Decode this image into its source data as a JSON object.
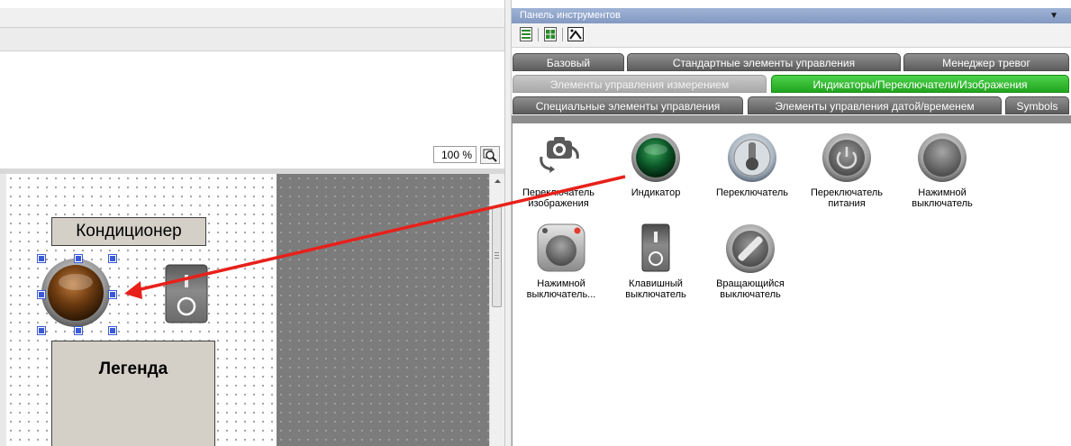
{
  "designer": {
    "zoom": "100 %",
    "label_top": "Кондиционер",
    "label_legend": "Легенда"
  },
  "toolbox": {
    "title": "Панель инструментов",
    "tabs_row1": [
      "Базовый",
      "Стандартные элементы управления",
      "Менеджер тревог"
    ],
    "tabs_row2": [
      "Элементы управления измерением",
      "Индикаторы/Переключатели/Изображения"
    ],
    "tabs_row3": [
      "Специальные элементы управления",
      "Элементы управления датой/временем",
      "Symbols"
    ],
    "active_tab": "Индикаторы/Переключатели/Изображения",
    "items_row1": [
      {
        "label": "Переключатель изображения",
        "icon": "image-switch-icon"
      },
      {
        "label": "Индикатор",
        "icon": "indicator-lamp-icon"
      },
      {
        "label": "Переключатель",
        "icon": "toggle-switch-icon"
      },
      {
        "label": "Переключатель питания",
        "icon": "power-switch-icon"
      },
      {
        "label": "Нажимной выключатель",
        "icon": "push-button-icon"
      }
    ],
    "items_row2": [
      {
        "label": "Нажимной выключатель...",
        "icon": "push-button-lamp-icon"
      },
      {
        "label": "Клавишный выключатель",
        "icon": "rocker-switch-icon"
      },
      {
        "label": "Вращающийся выключатель",
        "icon": "rotary-switch-icon"
      }
    ]
  },
  "colors": {
    "arrow": "#e8201a",
    "active_tab": "#2fb82c",
    "lamp_brown": "#6b3a10",
    "lamp_green": "#0d5a2a"
  }
}
